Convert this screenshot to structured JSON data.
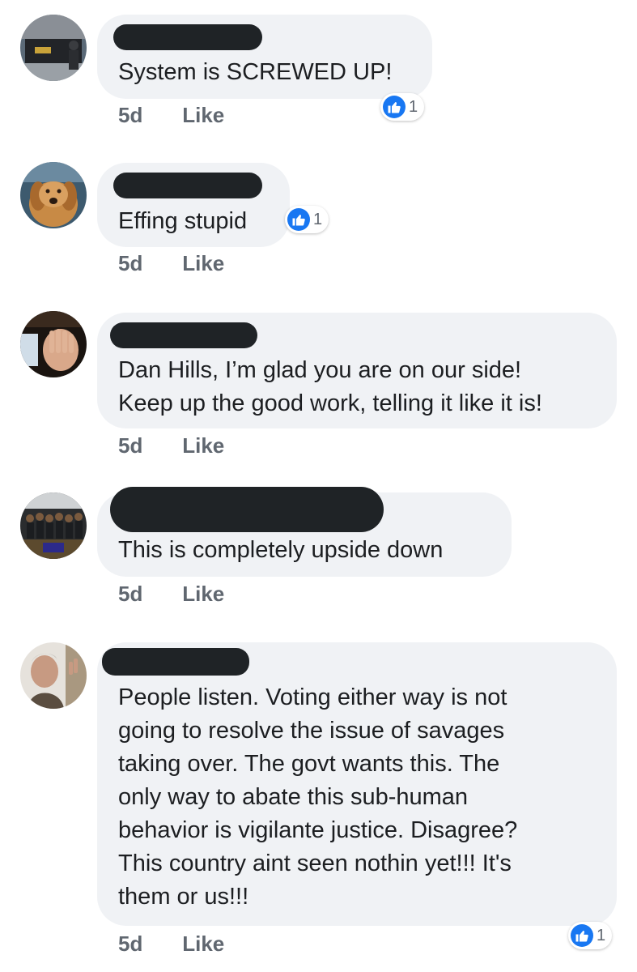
{
  "comments": [
    {
      "text": "System is SCREWED UP!",
      "time": "5d",
      "like_label": "Like",
      "reactions": {
        "icon": "like-icon",
        "count": "1"
      }
    },
    {
      "text": "Effing stupid",
      "time": "5d",
      "like_label": "Like",
      "reactions": {
        "icon": "like-icon",
        "count": "1"
      }
    },
    {
      "text": "Dan Hills, I’m glad you are on our side!\nKeep up the good work, telling it like it is!",
      "time": "5d",
      "like_label": "Like"
    },
    {
      "text": "This is completely upside down",
      "time": "5d",
      "like_label": "Like"
    },
    {
      "text": "People listen. Voting either way is not\ngoing to resolve the issue of savages\ntaking over. The govt wants this. The\nonly way to abate this sub-human\nbehavior is vigilante justice. Disagree?\nThis country aint seen nothin yet!!! It's\nthem or us!!!",
      "time": "5d",
      "like_label": "Like",
      "reactions": {
        "icon": "like-icon",
        "count": "1"
      }
    }
  ],
  "colors": {
    "bubble": "#f0f2f5",
    "redaction": "#1f2326",
    "like_blue": "#1877f2",
    "meta_gray": "#606770"
  }
}
